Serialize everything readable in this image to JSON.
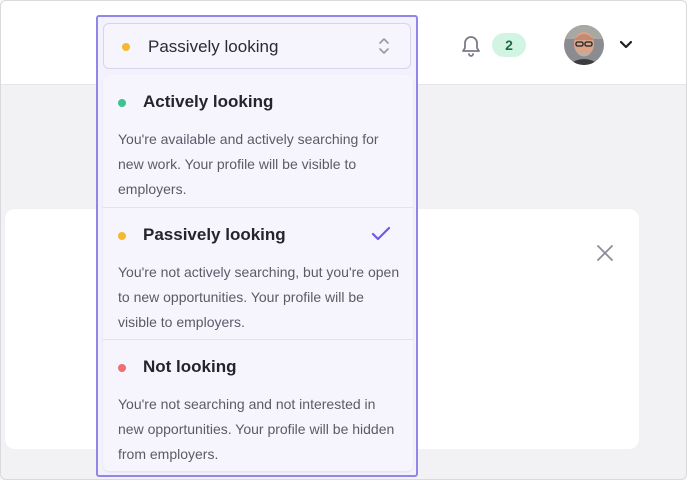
{
  "colors": {
    "accent": "#6c5ce7",
    "status_active": "#3cc48f",
    "status_passive": "#f5b82e",
    "status_not": "#ee6e73"
  },
  "status_select": {
    "selected_label": "Passively looking",
    "selected_status": "passive",
    "icon": "chevron-up-down-icon"
  },
  "notifications": {
    "icon": "bell-icon",
    "count": "2"
  },
  "user_menu": {
    "avatar": "avatar",
    "icon": "chevron-down-icon"
  },
  "options": [
    {
      "title": "Actively looking",
      "description": "You're available and actively searching for new work. Your profile will be visible to employers.",
      "status": "active",
      "selected": false
    },
    {
      "title": "Passively looking",
      "description": "You're not actively searching, but you're open to new opportunities. Your profile will be visible to employers.",
      "status": "passive",
      "selected": true
    },
    {
      "title": "Not looking",
      "description": "You're not searching and not interested in new opportunities. Your profile will be hidden from employers.",
      "status": "not",
      "selected": false
    }
  ],
  "card": {
    "close_icon": "close-icon"
  }
}
